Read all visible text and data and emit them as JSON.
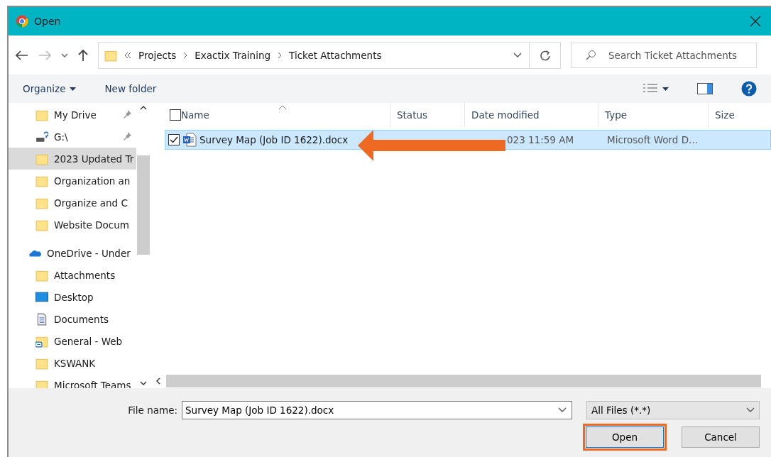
{
  "window": {
    "title": "Open"
  },
  "breadcrumb": [
    "Projects",
    "Exactix Training",
    "Ticket Attachments"
  ],
  "search": {
    "placeholder": "Search Ticket Attachments"
  },
  "toolbar": {
    "organize": "Organize",
    "new_folder": "New folder"
  },
  "sidebar": {
    "items": [
      {
        "kind": "folder",
        "label": "My Drive",
        "pinned": true,
        "selected": false
      },
      {
        "kind": "drive",
        "label": "G:\\",
        "pinned": true,
        "selected": false
      },
      {
        "kind": "folder",
        "label": "2023 Updated Tr",
        "pinned": false,
        "selected": true
      },
      {
        "kind": "folder",
        "label": "Organization an",
        "pinned": false,
        "selected": false
      },
      {
        "kind": "folder",
        "label": "Organize and C",
        "pinned": false,
        "selected": false
      },
      {
        "kind": "folder",
        "label": "Website Docum",
        "pinned": false,
        "selected": false
      },
      {
        "kind": "onedrive",
        "label": "OneDrive - Under",
        "pinned": false,
        "selected": false
      },
      {
        "kind": "folder",
        "label": "Attachments",
        "pinned": false,
        "selected": false
      },
      {
        "kind": "desktop",
        "label": "Desktop",
        "pinned": false,
        "selected": false
      },
      {
        "kind": "documents",
        "label": "Documents",
        "pinned": false,
        "selected": false
      },
      {
        "kind": "shared",
        "label": "General - Web",
        "pinned": false,
        "selected": false
      },
      {
        "kind": "folder",
        "label": "KSWANK",
        "pinned": false,
        "selected": false
      },
      {
        "kind": "folder",
        "label": "Microsoft Teams",
        "pinned": false,
        "selected": false
      }
    ]
  },
  "table": {
    "select_all_checked": false,
    "columns": [
      "Name",
      "Status",
      "Date modified",
      "Type",
      "Size"
    ],
    "rows": [
      {
        "name": "Survey Map (Job ID 1622).docx",
        "date_modified": "023 11:59 AM",
        "type": "Microsoft Word D...",
        "checked": true,
        "selected": true
      }
    ]
  },
  "annotation": {
    "arrow": true
  },
  "footer": {
    "file_name_label": "File name:",
    "file_name": "Survey Map (Job ID 1622).docx",
    "file_type": "All Files (*.*)",
    "buttons": [
      {
        "label": "Open",
        "highlighted": true
      },
      {
        "label": "Cancel",
        "highlighted": false
      }
    ]
  }
}
